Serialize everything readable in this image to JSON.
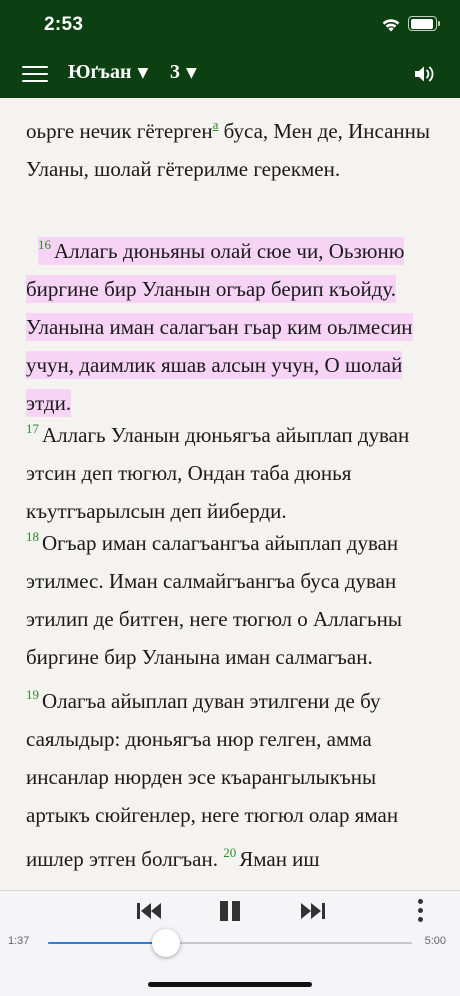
{
  "status_bar": {
    "time": "2:53"
  },
  "header": {
    "book": "Юґъан",
    "chapter": "3",
    "icons": {
      "menu": "hamburger-menu-icon",
      "audio": "speaker-icon"
    }
  },
  "text": {
    "line_cont_1": "оьрге нечик гётерген",
    "footnote": "a",
    "line_cont_2": " буса, Мен де, Инсанны Уланы, шолай гётерилме герекмен.",
    "v16_num": "16",
    "v16_text": "Аллагь дюньяны олай сюе чи, Оьзюню биргине бир Уланын огъар берип къойду. Уланына иман салагъан гьар ким оьлмесин учун, даимлик яшав алсын учун, О шолай этди.",
    "v17_num": "17",
    "v17_text": "Аллагь Уланын дюньягъа айыплап дуван этсин деп тюгюл, Ондан таба дюнья къутгъарылсын деп йиберди.",
    "v18_num": "18",
    "v18_text": "Огъар иман салагъангъа айыплап дуван этилмес. Иман салмайгъангъа буса дуван этилип де битген, неге тюгюл о Аллагьны биргине бир Уланына иман салмагъан.",
    "v19_num": "19",
    "v19_text": "Олагъа айыплап дуван этилгени де бу саялыдыр: дюньягъа нюр гелген, амма инсанлар нюрден эсе къарангылыкъны артыкъ сюйгенлер, неге тюгюл олар яман ишлер этген болгъан.",
    "v20_num": "20",
    "v20_text": "Яман иш"
  },
  "highlight_color": "#f7d4f6",
  "verse_number_color": "#2d8a2d",
  "header_color": "#0c3f12",
  "player": {
    "elapsed": "1:37",
    "total": "5:00",
    "progress": 0.323,
    "icons": {
      "prev": "skip-back-icon",
      "pause": "pause-icon",
      "next": "skip-forward-icon",
      "more": "more-vertical-icon"
    }
  }
}
